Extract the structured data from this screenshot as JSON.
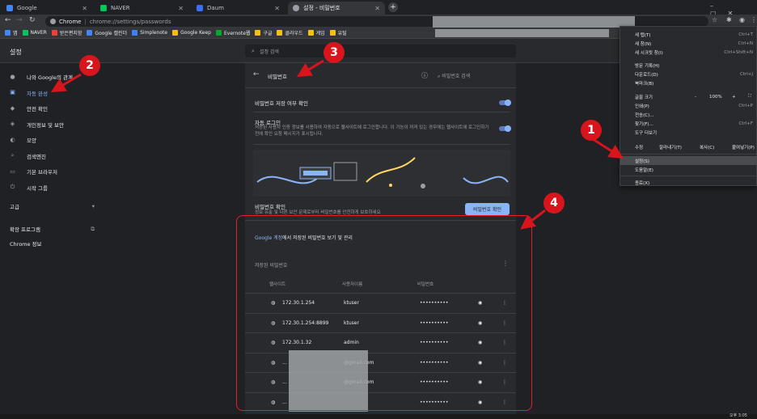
{
  "tabs": [
    {
      "label": "Google",
      "color": "#4285f4"
    },
    {
      "label": "NAVER",
      "color": "#03c75a"
    },
    {
      "label": "Daum",
      "color": "#3a6eff"
    },
    {
      "label": "설정 - 비밀번호",
      "color": "#9aa0a6"
    }
  ],
  "address": {
    "scheme_label": "Chrome",
    "url": "chrome://settings/passwords"
  },
  "bookmarks": [
    {
      "label": "앱",
      "color": "#4285f4"
    },
    {
      "label": "NAVER",
      "color": "#03c75a"
    },
    {
      "label": "받은편지함",
      "color": "#ea4335"
    },
    {
      "label": "Google 캘린더",
      "color": "#4285f4"
    },
    {
      "label": "Simplenote",
      "color": "#3b82f6"
    },
    {
      "label": "Google Keep",
      "color": "#fbbc04"
    },
    {
      "label": "Evernote웹",
      "color": "#00a82d"
    },
    {
      "label": "구글",
      "color": "#f4c20d"
    },
    {
      "label": "클라우드",
      "color": "#f4c20d"
    },
    {
      "label": "게임",
      "color": "#f4c20d"
    },
    {
      "label": "유틸",
      "color": "#f4c20d"
    }
  ],
  "header": {
    "title": "설정",
    "search_placeholder": "설정 검색"
  },
  "sidebar": {
    "items": [
      {
        "label": "나와 Google의 관계",
        "icon": "person-icon",
        "glyph": "●"
      },
      {
        "label": "자동 완성",
        "icon": "autofill-icon",
        "glyph": "▣",
        "selected": true
      },
      {
        "label": "안전 확인",
        "icon": "shield-icon",
        "glyph": "◆"
      },
      {
        "label": "개인정보 및 보안",
        "icon": "security-icon",
        "glyph": "◈"
      },
      {
        "label": "모양",
        "icon": "palette-icon",
        "glyph": "◐"
      },
      {
        "label": "검색엔진",
        "icon": "search-icon",
        "glyph": "⌕"
      },
      {
        "label": "기본 브라우저",
        "icon": "browser-icon",
        "glyph": "▭"
      },
      {
        "label": "시작 그룹",
        "icon": "power-icon",
        "glyph": "⏻"
      }
    ],
    "advanced": "고급",
    "extensions": "확장 프로그램",
    "about": "Chrome 정보"
  },
  "passwords": {
    "back": "←",
    "title": "비밀번호",
    "search_placeholder": "비밀번호 검색",
    "offer_save": "비밀번호 저장 여부 확인",
    "auto_signin": "자동 로그인",
    "auto_signin_desc": "저장된 사용자 인증 정보를 사용하여 자동으로 웹사이트에 로그인합니다. 이 기능이 꺼져 있는 경우에는 웹사이트에 로그인하기 전에 확인 요청 메시지가 표시됩니다.",
    "check_title": "비밀번호 확인",
    "check_desc": "정보 유출 및 다른 보안 문제로부터 비밀번호를 안전하게 보호하세요",
    "check_button": "비밀번호 확인",
    "manage_prefix": "Google 계정",
    "manage_text": "에서 저장된 비밀번호 보기 및 관리",
    "saved_title": "저장된 비밀번호",
    "col_site": "웹사이트",
    "col_user": "사용자이름",
    "col_pass": "비밀번호",
    "entries": [
      {
        "site": "172.30.1.254",
        "user": "ktuser",
        "pass": "••••••••••"
      },
      {
        "site": "172.30.1.254:8899",
        "user": "ktuser",
        "pass": "••••••••••"
      },
      {
        "site": "172.30.1.32",
        "user": "admin",
        "pass": "••••••••••"
      },
      {
        "site": "...",
        "user": "@gmail.com",
        "pass": "••••••••••"
      },
      {
        "site": "...",
        "user": "@gmail.com",
        "pass": "••••••••••"
      },
      {
        "site": "...",
        "user": "",
        "pass": "••••••••••"
      }
    ]
  },
  "menu": {
    "items": [
      {
        "label": "새 탭(T)",
        "shortcut": "Ctrl+T"
      },
      {
        "label": "새 창(N)",
        "shortcut": "Ctrl+N"
      },
      {
        "label": "새 시크릿 창(I)",
        "shortcut": "Ctrl+Shift+N"
      },
      {
        "label": "방문 기록(H)",
        "shortcut": ""
      },
      {
        "label": "다운로드(D)",
        "shortcut": "Ctrl+J"
      },
      {
        "label": "북마크(B)",
        "shortcut": ""
      },
      {
        "label": "인쇄(P)",
        "shortcut": "Ctrl+P"
      },
      {
        "label": "전송(C)...",
        "shortcut": ""
      },
      {
        "label": "찾기(F)...",
        "shortcut": "Ctrl+F"
      },
      {
        "label": "도구 더보기",
        "shortcut": ""
      }
    ],
    "zoom_label": "글꼴 크기",
    "zoom_minus": "-",
    "zoom_value": "100%",
    "zoom_plus": "+",
    "edit_label": "수정",
    "cut": "잘라내기(T)",
    "copy": "복사(C)",
    "paste": "붙여넣기(P)",
    "settings": "설정(S)",
    "help": "도움말(E)",
    "exit": "종료(X)"
  },
  "annotations": [
    "1",
    "2",
    "3",
    "4"
  ],
  "taskbar_time": "오후 3:05"
}
